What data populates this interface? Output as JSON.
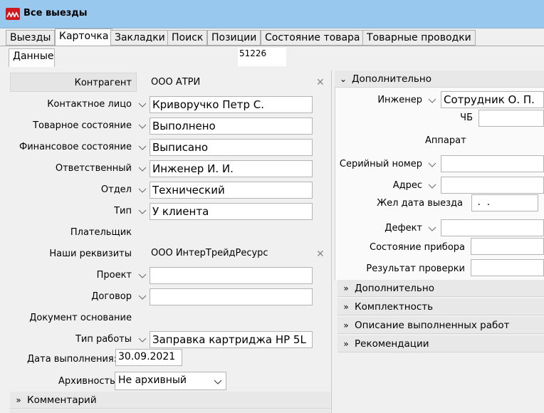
{
  "window": {
    "title": "Все выезды"
  },
  "tabs": [
    {
      "label": "Выезды"
    },
    {
      "label": "Карточка"
    },
    {
      "label": "Закладки"
    },
    {
      "label": "Поиск"
    },
    {
      "label": "Позиции"
    },
    {
      "label": "Состояние товара"
    },
    {
      "label": "Товарные проводки"
    }
  ],
  "subtab": {
    "label": "Данные"
  },
  "card_number": "51226",
  "left": {
    "contragent": {
      "label": "Контрагент",
      "value": "ООО АТРИ"
    },
    "contact_person": {
      "label": "Контактное лицо",
      "value": "Криворучко Петр С."
    },
    "goods_state": {
      "label": "Товарное состояние",
      "value": "Выполнено"
    },
    "finance_state": {
      "label": "Финансовое состояние",
      "value": "Выписано"
    },
    "responsible": {
      "label": "Ответственный",
      "value": "Инженер И. И."
    },
    "department": {
      "label": "Отдел",
      "value": "Технический"
    },
    "type": {
      "label": "Тип",
      "value": "У клиента"
    },
    "payer": {
      "label": "Плательщик",
      "value": ""
    },
    "our_details": {
      "label": "Наши реквизиты",
      "value": "ООО ИнтерТрейдРесурс"
    },
    "project": {
      "label": "Проект",
      "value": ""
    },
    "contract": {
      "label": "Договор",
      "value": ""
    },
    "base_doc": {
      "label": "Документ основание",
      "value": ""
    },
    "work_type": {
      "label": "Тип работы",
      "value": "Заправка картриджа HP 5L"
    },
    "done_date": {
      "label": "Дата выполнения:",
      "value": "30.09.2021"
    },
    "archive": {
      "label": "Архивность",
      "value": "Не архивный"
    },
    "comment_section": {
      "label": "Комментарий"
    }
  },
  "right": {
    "extra_open": {
      "label": "Дополнительно"
    },
    "engineer": {
      "label": "Инженер",
      "value": "Сотрудник О. П."
    },
    "bw": {
      "label": "ЧБ",
      "value": ""
    },
    "device_heading": "Аппарат",
    "serial": {
      "label": "Серийный номер",
      "value": ""
    },
    "address": {
      "label": "Адрес",
      "value": ""
    },
    "desired_date": {
      "label": "Жел дата выезда",
      "value": " .  ."
    },
    "defect": {
      "label": "Дефект",
      "value": ""
    },
    "device_state": {
      "label": "Состояние прибора",
      "value": ""
    },
    "check_result": {
      "label": "Результат проверки",
      "value": ""
    },
    "sections": [
      {
        "label": "Дополнительно"
      },
      {
        "label": "Комплектность"
      },
      {
        "label": "Описание выполненных работ"
      },
      {
        "label": "Рекомендации"
      }
    ]
  },
  "icons": {
    "clear": "x-icon",
    "dropdown": "chevron-down-icon",
    "expand": "double-chevron-right-icon",
    "collapse": "double-chevron-down-icon"
  }
}
